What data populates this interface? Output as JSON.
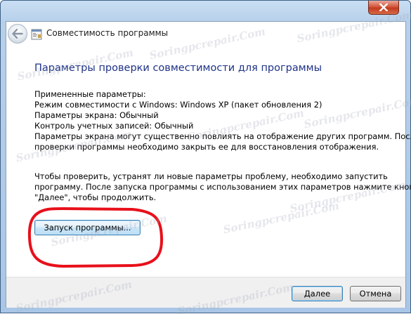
{
  "window": {
    "title": "Совместимость программы",
    "close_glyph": "✕"
  },
  "content": {
    "heading": "Параметры проверки совместимости для программы",
    "applied_label": "Примененные параметры:",
    "compat_mode": "Режим совместимости с Windows: Windows XP (пакет обновления 2)",
    "display_settings": "Параметры экрана:  Обычный",
    "uac": "Контроль учетных записей:  Обычный",
    "warning_line1": "Параметры экрана могут существенно повлиять на отображение других программ. После",
    "warning_line2": "проверки программы необходимо закрыть ее для восстановления отображения.",
    "instruction_line1": "Чтобы проверить, устранят ли новые параметры проблему, необходимо запустить",
    "instruction_line2": "программу. После запуска программы с использованием этих параметров нажмите кнопку",
    "instruction_line3": "\"Далее\", чтобы продолжить.",
    "launch_button": "Запуск программы..."
  },
  "footer": {
    "next_button": "Далее",
    "cancel_button": "Отмена"
  },
  "watermark": {
    "text": "Soringpcrepair.Com"
  },
  "colors": {
    "heading": "#1e3287",
    "highlight": "#e8101a",
    "frame": "#b7d0ea"
  },
  "icons": {
    "back": "back-arrow-icon",
    "app": "compatibility-icon",
    "close": "close-icon"
  }
}
